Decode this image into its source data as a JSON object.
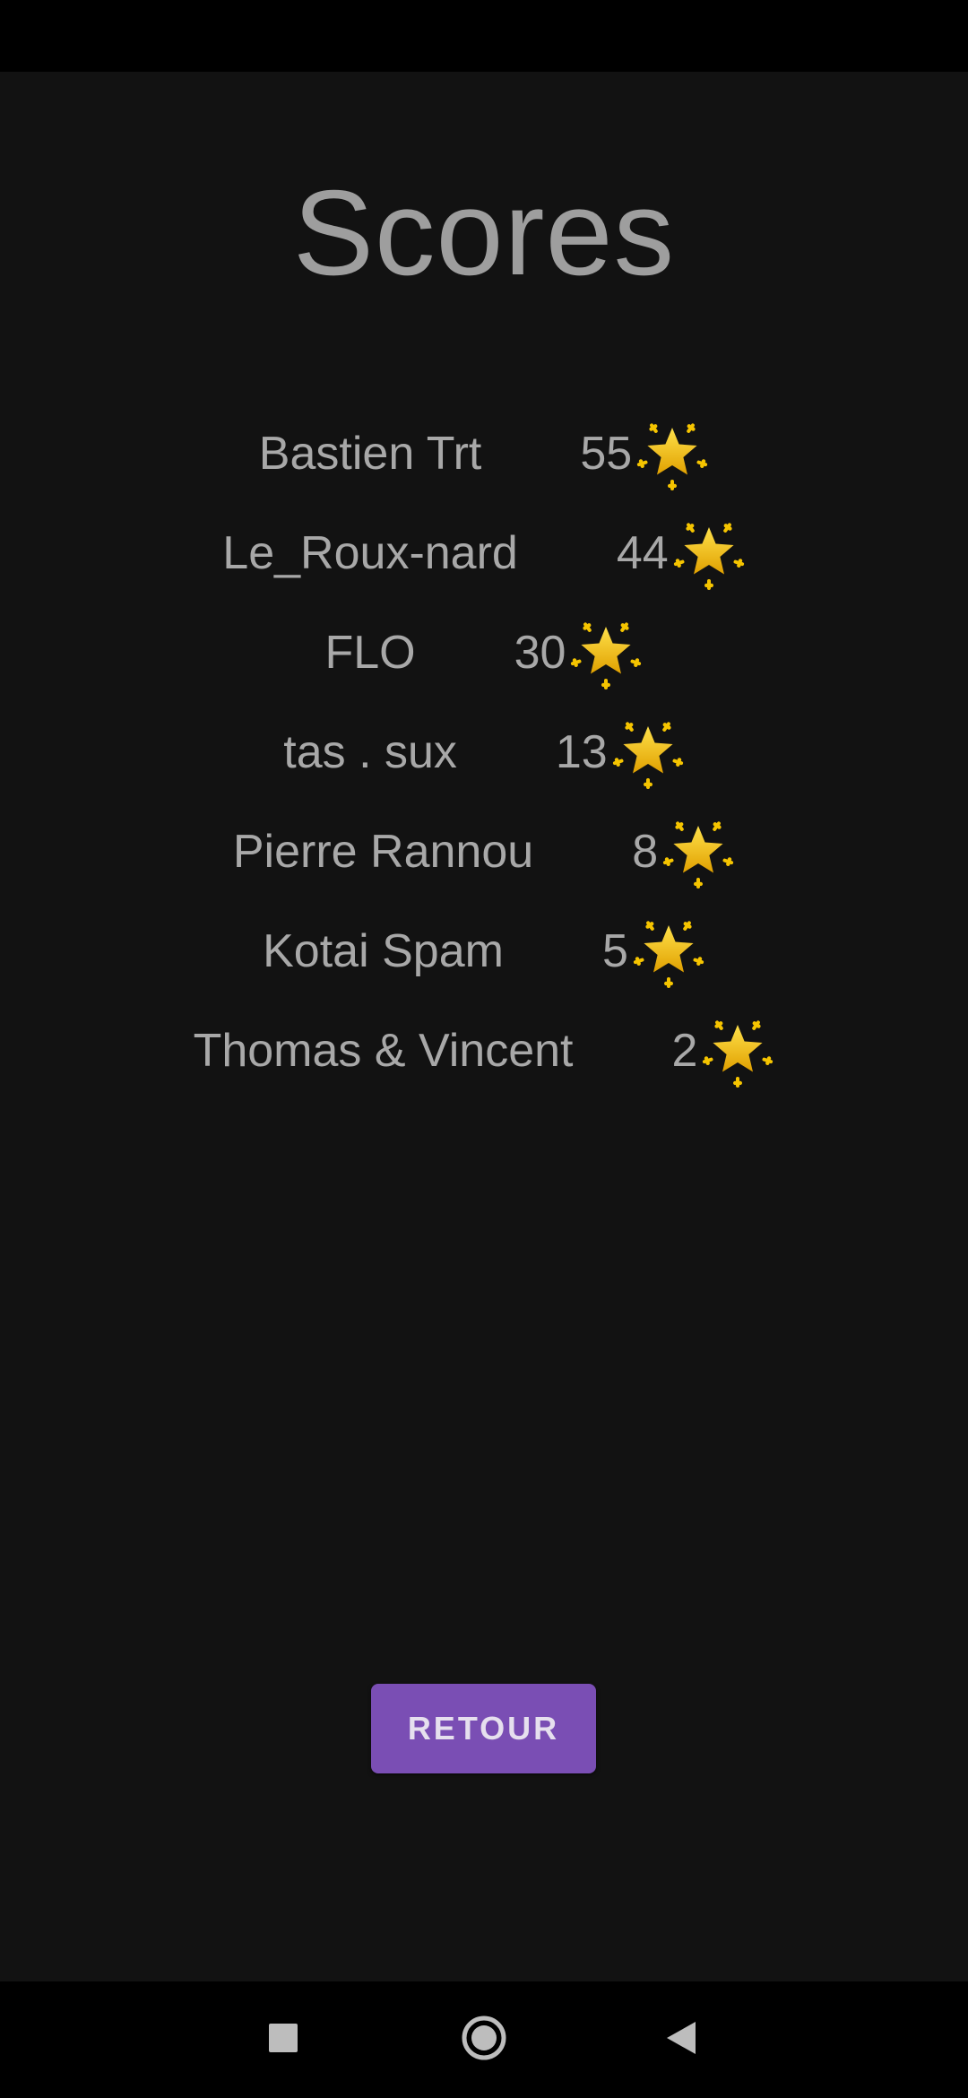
{
  "screen": {
    "title": "Scores"
  },
  "scores": [
    {
      "name": "Bastien Trt",
      "score": "55"
    },
    {
      "name": "Le_Roux-nard",
      "score": "44"
    },
    {
      "name": "FLO",
      "score": "30"
    },
    {
      "name": "tas . sux",
      "score": "13"
    },
    {
      "name": "Pierre Rannou",
      "score": "8"
    },
    {
      "name": "Kotai Spam",
      "score": "5"
    },
    {
      "name": "Thomas & Vincent",
      "score": "2"
    }
  ],
  "score_icon": "glowing-star-icon",
  "buttons": {
    "back_label": "RETOUR"
  },
  "nav_icons": [
    "recents-square-icon",
    "home-circle-icon",
    "back-triangle-icon"
  ],
  "colors": {
    "background": "#121212",
    "text": "#a8a8a8",
    "button": "#7a4eb4",
    "star": "#f5c400"
  }
}
